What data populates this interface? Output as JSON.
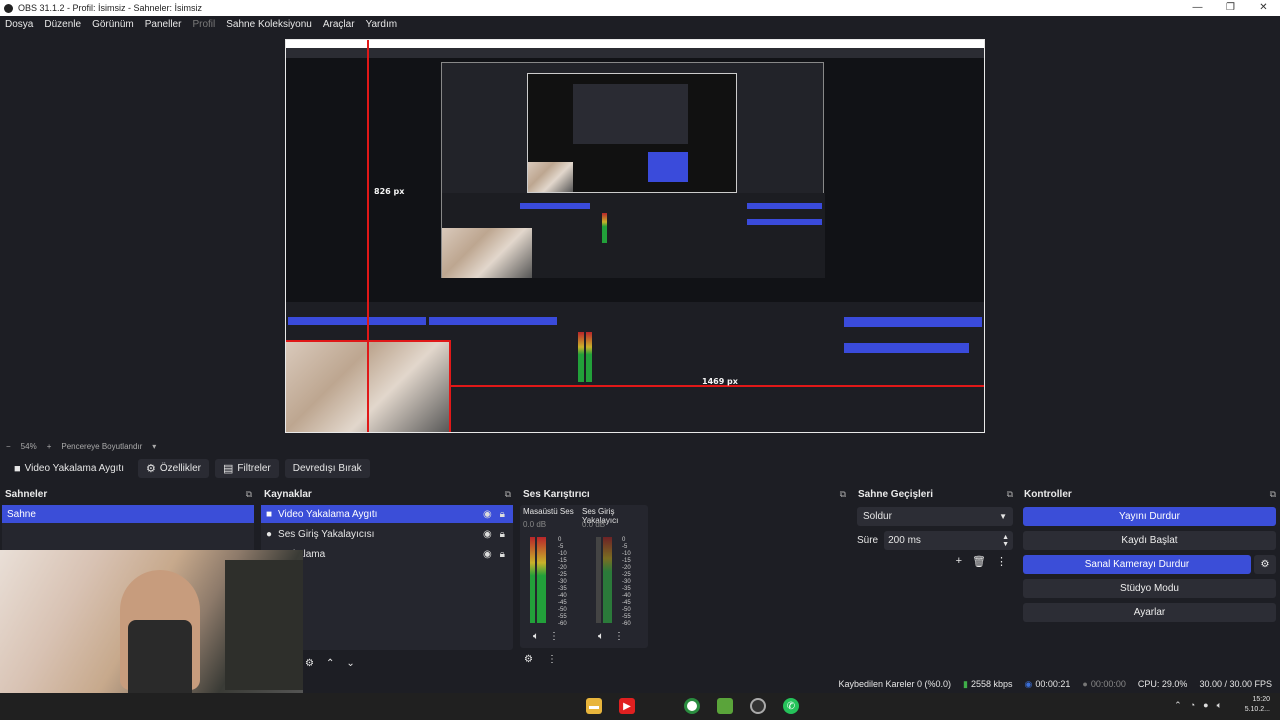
{
  "window": {
    "title": "OBS 31.1.2 - Profil: İsimsiz - Sahneler: İsimsiz"
  },
  "menu": [
    {
      "label": "Dosya",
      "enabled": true
    },
    {
      "label": "Düzenle",
      "enabled": true
    },
    {
      "label": "Görünüm",
      "enabled": true
    },
    {
      "label": "Paneller",
      "enabled": true
    },
    {
      "label": "Profil",
      "enabled": false
    },
    {
      "label": "Sahne Koleksiyonu",
      "enabled": true
    },
    {
      "label": "Araçlar",
      "enabled": true
    },
    {
      "label": "Yardım",
      "enabled": true
    }
  ],
  "preview": {
    "height_label": "826 px",
    "width_label": "1469 px"
  },
  "zoom": {
    "value": "54%",
    "mode": "Pencereye Boyutlandır"
  },
  "source_toolbar": {
    "source_name": "Video Yakalama Aygıtı",
    "properties": "Özellikler",
    "filters": "Filtreler",
    "deactivate": "Devredışı Bırak"
  },
  "scenes": {
    "title": "Sahneler",
    "items": [
      "Sahne"
    ]
  },
  "sources": {
    "title": "Kaynaklar",
    "items": [
      {
        "label": "Video Yakalama Aygıtı",
        "icon": "camera-icon"
      },
      {
        "label": "Ses Giriş Yakalayıcısı",
        "icon": "microphone-icon"
      },
      {
        "label": "Yakalama",
        "icon": "monitor-icon"
      }
    ]
  },
  "mixer": {
    "title": "Ses Karıştırıcı",
    "channels": [
      {
        "name": "Masaüstü Ses",
        "db": "0.0 dB"
      },
      {
        "name": "Ses Giriş Yakalayıcı",
        "db": "0.0 dB"
      }
    ],
    "scale": [
      "0",
      "-5",
      "-10",
      "-15",
      "-20",
      "-25",
      "-30",
      "-35",
      "-40",
      "-45",
      "-50",
      "-55",
      "-60"
    ]
  },
  "transitions": {
    "title": "Sahne Geçişleri",
    "selected": "Soldur",
    "duration_label": "Süre",
    "duration": "200 ms"
  },
  "controls": {
    "title": "Kontroller",
    "stop_stream": "Yayını Durdur",
    "start_record": "Kaydı Başlat",
    "stop_virtualcam": "Sanal Kamerayı Durdur",
    "studio_mode": "Stüdyo Modu",
    "settings": "Ayarlar"
  },
  "status": {
    "dropped": "Kaybedilen Kareler 0 (%0.0)",
    "bitrate": "2558 kbps",
    "stream_time": "00:00:21",
    "rec_time": "00:00:00",
    "cpu": "CPU: 29.0%",
    "fps": "30.00 / 30.00 FPS"
  },
  "clock": {
    "time": "15:20",
    "date": "5.10.2..."
  },
  "colors": {
    "accent": "#3b4ed8",
    "red": "#e01818",
    "bg": "#1d1e24",
    "panel": "#25262e"
  }
}
